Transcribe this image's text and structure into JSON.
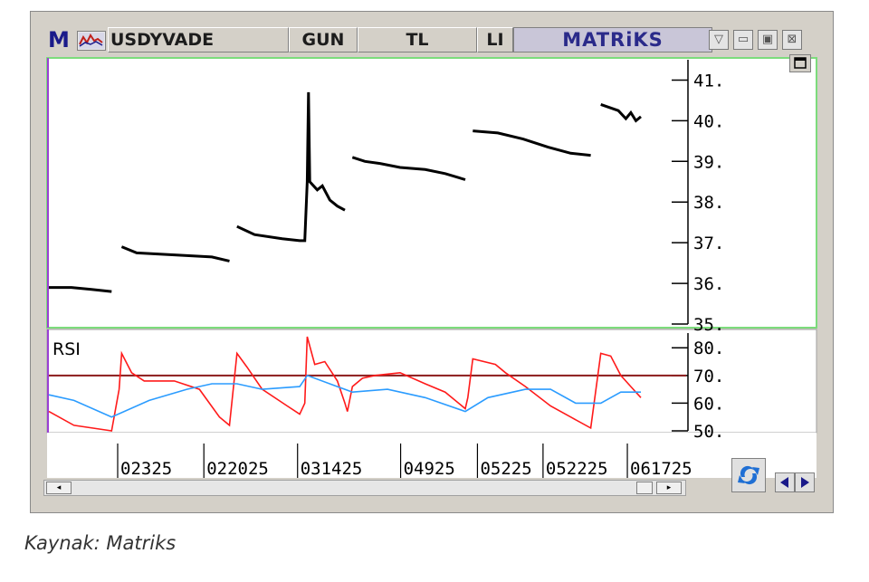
{
  "window": {
    "logo": "M",
    "symbol": "USDYVADE",
    "period": "GUN",
    "currency": "TL",
    "field4": "LI",
    "brand": "MATRiKS"
  },
  "caption": "Kaynak: Matriks",
  "colors": {
    "price": "#000000",
    "rsi": "#ff1a1a",
    "rsi_signal": "#2b9cff",
    "rsi_threshold": "#8b1a1a",
    "frame": "#7cdc7c"
  },
  "icons": [
    "chart-icon",
    "dropdown-icon",
    "minimize-icon",
    "maximize-icon",
    "close-icon",
    "refresh-icon",
    "left-arrow-icon",
    "right-arrow-icon"
  ],
  "chart_data": [
    {
      "type": "line",
      "title": "",
      "ylabel": "",
      "ylim": [
        35,
        41.5
      ],
      "y_ticks": [
        "41.",
        "40.",
        "39.",
        "38.",
        "37.",
        "36.",
        "35."
      ],
      "y_tick_values": [
        41,
        40,
        39,
        38,
        37,
        36,
        35
      ],
      "series": [
        {
          "values": [
            [
              0,
              35.9
            ],
            [
              9,
              35.9
            ],
            [
              17,
              35.85
            ],
            [
              25,
              35.8
            ],
            [
              29,
              36.9
            ],
            [
              35,
              36.75
            ],
            [
              50,
              36.7
            ],
            [
              65,
              36.65
            ],
            [
              72,
              36.55
            ],
            [
              75,
              37.4
            ],
            [
              82,
              37.2
            ],
            [
              93,
              37.1
            ],
            [
              100,
              37.05
            ],
            [
              102,
              37.05
            ],
            [
              103,
              38.5
            ],
            [
              103.5,
              40.7
            ],
            [
              104,
              38.5
            ],
            [
              107,
              38.3
            ],
            [
              109,
              38.4
            ],
            [
              112,
              38.05
            ],
            [
              115,
              37.9
            ],
            [
              118,
              37.8
            ],
            [
              121,
              39.1
            ],
            [
              126,
              39.0
            ],
            [
              132,
              38.95
            ],
            [
              140,
              38.85
            ],
            [
              150,
              38.8
            ],
            [
              158,
              38.7
            ],
            [
              166,
              38.55
            ],
            [
              169,
              39.75
            ],
            [
              179,
              39.7
            ],
            [
              189,
              39.55
            ],
            [
              199,
              39.35
            ],
            [
              208,
              39.2
            ],
            [
              216,
              39.15
            ],
            [
              220,
              40.4
            ],
            [
              227,
              40.25
            ],
            [
              230,
              40.05
            ],
            [
              232,
              40.2
            ],
            [
              234,
              40.0
            ],
            [
              236,
              40.1
            ]
          ]
        }
      ]
    },
    {
      "type": "line",
      "title": "RSI",
      "ylim": [
        50,
        84
      ],
      "y_ticks": [
        "80.",
        "70.",
        "60.",
        "50."
      ],
      "y_tick_values": [
        80,
        70,
        60,
        50
      ],
      "threshold": 70,
      "x_tick_labels": [
        "02325",
        "022025",
        "031425",
        "04925",
        "05225",
        "052225",
        "061725"
      ],
      "series": [
        {
          "name": "RSI",
          "values": [
            [
              0,
              57
            ],
            [
              10,
              52
            ],
            [
              25,
              50
            ],
            [
              28,
              65
            ],
            [
              29,
              78
            ],
            [
              33,
              71
            ],
            [
              38,
              68
            ],
            [
              50,
              68
            ],
            [
              60,
              65
            ],
            [
              68,
              55
            ],
            [
              72,
              52
            ],
            [
              75,
              78
            ],
            [
              79,
              73
            ],
            [
              85,
              65
            ],
            [
              95,
              59
            ],
            [
              100,
              56
            ],
            [
              102,
              60
            ],
            [
              103,
              84
            ],
            [
              106,
              74
            ],
            [
              110,
              75
            ],
            [
              115,
              68
            ],
            [
              118,
              60
            ],
            [
              119,
              57
            ],
            [
              121,
              66
            ],
            [
              125,
              69
            ],
            [
              130,
              70
            ],
            [
              140,
              71
            ],
            [
              150,
              67
            ],
            [
              158,
              64
            ],
            [
              166,
              58
            ],
            [
              167,
              62
            ],
            [
              169,
              76
            ],
            [
              178,
              74
            ],
            [
              182,
              71
            ],
            [
              190,
              66
            ],
            [
              200,
              59
            ],
            [
              208,
              55
            ],
            [
              216,
              51
            ],
            [
              220,
              78
            ],
            [
              224,
              77
            ],
            [
              228,
              70
            ],
            [
              232,
              66
            ],
            [
              236,
              62
            ]
          ]
        },
        {
          "name": "RSI signal",
          "values": [
            [
              0,
              63
            ],
            [
              10,
              61
            ],
            [
              25,
              55
            ],
            [
              40,
              61
            ],
            [
              55,
              65
            ],
            [
              65,
              67
            ],
            [
              75,
              67
            ],
            [
              85,
              65
            ],
            [
              100,
              66
            ],
            [
              103,
              70
            ],
            [
              115,
              66
            ],
            [
              121,
              64
            ],
            [
              135,
              65
            ],
            [
              150,
              62
            ],
            [
              166,
              57
            ],
            [
              175,
              62
            ],
            [
              190,
              65
            ],
            [
              200,
              65
            ],
            [
              210,
              60
            ],
            [
              220,
              60
            ],
            [
              228,
              64
            ],
            [
              236,
              64
            ]
          ]
        }
      ]
    }
  ]
}
